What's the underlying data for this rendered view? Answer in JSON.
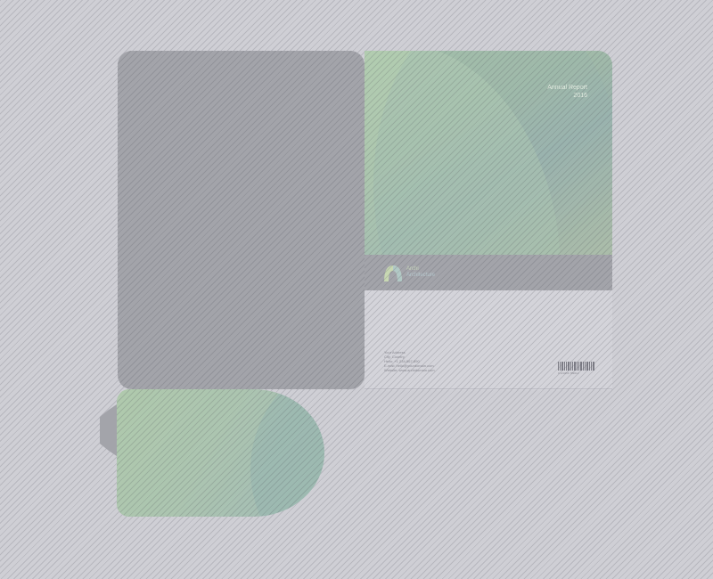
{
  "cover": {
    "title": "Annual Report",
    "year": "2016"
  },
  "logo": {
    "icon": "arch-logo-icon",
    "brand": "Archi",
    "tagline": "Architecture"
  },
  "contact": {
    "lines": [
      "Your Address",
      "City, Country",
      "Hello: +1 234-567-890",
      "E-mail: hello@yourdomain.com",
      "Website: www.archidomain.com"
    ]
  },
  "barcode": {
    "number": "0  123456 789012"
  },
  "colors": {
    "background": "#cfcfd5",
    "panel_grey": "#a3a4aa",
    "gradient_green": "#a7c3a8",
    "gradient_teal": "#9bb3ae"
  }
}
